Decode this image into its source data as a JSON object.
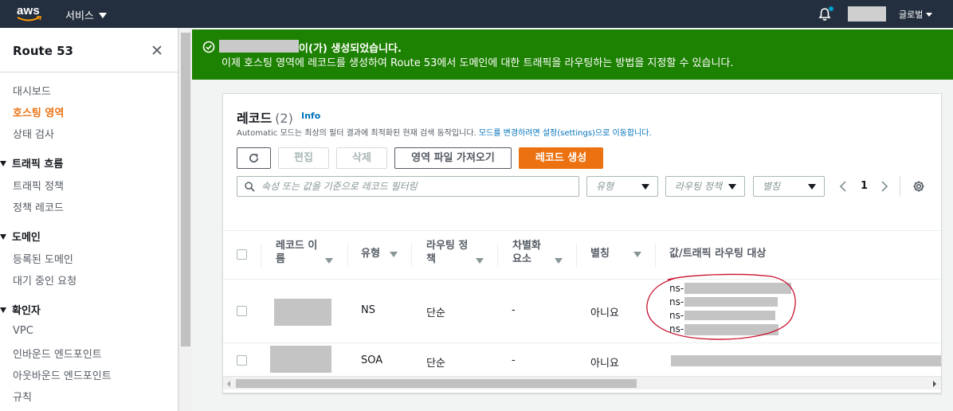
{
  "nav": {
    "logo": "aws",
    "services_label": "서비스",
    "region_label": "글로벌",
    "icons": [
      "bell-icon",
      "caret-down-icon"
    ],
    "accent": "#ec7211"
  },
  "sidebar": {
    "title": "Route 53",
    "items": [
      {
        "label": "대시보드"
      },
      {
        "label": "호스팅 영역",
        "active": true
      },
      {
        "label": "상태 검사"
      }
    ],
    "groups": [
      {
        "label": "트래픽 흐름",
        "items": [
          {
            "label": "트래픽 정책"
          },
          {
            "label": "정책 레코드"
          }
        ]
      },
      {
        "label": "도메인",
        "items": [
          {
            "label": "등록된 도메인"
          },
          {
            "label": "대기 중인 요청"
          }
        ]
      },
      {
        "label": "확인자",
        "items": [
          {
            "label": "VPC"
          },
          {
            "label": "인바운드 엔드포인트"
          },
          {
            "label": "아웃바운드 엔드포인트"
          },
          {
            "label": "규칙"
          }
        ]
      }
    ]
  },
  "flash": {
    "title_suffix": "이(가) 생성되었습니다.",
    "message": "이제 호스팅 영역에 레코드를 생성하여 Route 53에서 도메인에 대한 트래픽을 라우팅하는 방법을 지정할 수 있습니다.",
    "color": "#1d8102"
  },
  "records": {
    "title": "레코드",
    "count": "(2)",
    "info": "Info",
    "desc_prefix": "Automatic 모드는 최상의 필터 결과에 최적화된 현재 검색 동작입니다.",
    "desc_link": "모드를 변경하려면 설정(settings)으로 이동합니다.",
    "buttons": {
      "edit": "편집",
      "delete": "삭제",
      "import": "영역 파일 가져오기",
      "create": "레코드 생성"
    },
    "filter_placeholder": "속성 또는 값을 기준으로 레코드 필터링",
    "selects": {
      "type": "유형",
      "routing": "라우팅 정책",
      "alias": "별칭"
    },
    "page": "1",
    "columns": [
      {
        "label": "레코드 이름"
      },
      {
        "label": "유형"
      },
      {
        "label": "라우팅 정책"
      },
      {
        "label": "차별화 요소"
      },
      {
        "label": "별칭"
      },
      {
        "label": "값/트래픽 라우팅 대상"
      }
    ],
    "rows": [
      {
        "type": "NS",
        "routing": "단순",
        "diff": "-",
        "alias": "아니요",
        "values": [
          "ns-",
          "ns-",
          "ns-",
          "ns-"
        ]
      },
      {
        "type": "SOA",
        "routing": "단순",
        "diff": "-",
        "alias": "아니요"
      }
    ]
  }
}
